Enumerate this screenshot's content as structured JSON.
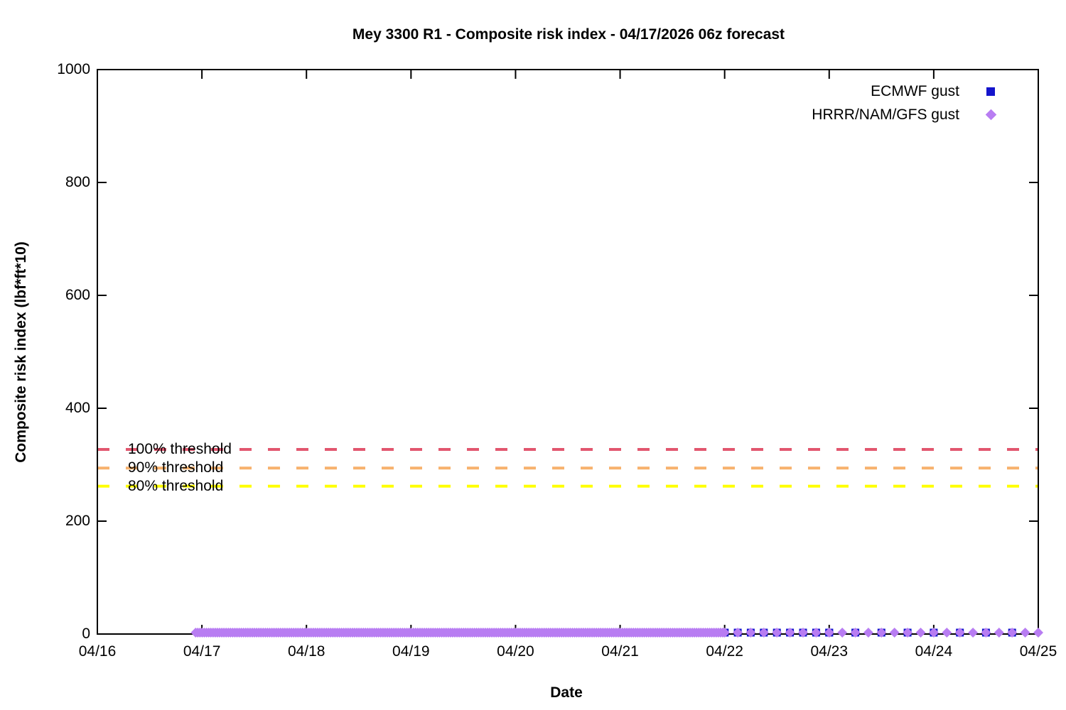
{
  "thresholds": [
    {
      "label": "100% threshold",
      "value": 327,
      "color": "#e2566e"
    },
    {
      "label": "90% threshold",
      "value": 294,
      "color": "#f7b16c"
    },
    {
      "label": "80% threshold",
      "value": 262,
      "color": "#ffff00"
    }
  ],
  "legend": {
    "items": [
      {
        "label": "ECMWF gust",
        "marker": "square",
        "color": "#1414cc"
      },
      {
        "label": "HRRR/NAM/GFS gust",
        "marker": "diamond",
        "color": "#b87df2"
      }
    ]
  },
  "chart_data": {
    "type": "scatter",
    "title": "Mey 3300 R1 - Composite risk index - 04/17/2026 06z forecast",
    "xlabel": "Date",
    "ylabel": "Composite risk index (lbf*ft*10)",
    "x_tick_labels": [
      "04/16",
      "04/17",
      "04/18",
      "04/19",
      "04/20",
      "04/21",
      "04/22",
      "04/23",
      "04/24",
      "04/25"
    ],
    "x_range_days": [
      16,
      25
    ],
    "y_ticks": [
      0,
      200,
      400,
      600,
      800,
      1000
    ],
    "ylim": [
      0,
      1000
    ],
    "grid": false,
    "legend_position": "top-right-inside",
    "series": [
      {
        "name": "ECMWF gust",
        "marker": "square",
        "color": "#1414cc",
        "value": 0,
        "sampling": [
          {
            "start_day": 17.0,
            "end_day": 22.0,
            "interval_hours": 1
          },
          {
            "start_day": 22.0,
            "end_day": 23.0,
            "interval_hours": 3
          },
          {
            "start_day": 23.0,
            "end_day": 24.75,
            "interval_hours": 6
          }
        ]
      },
      {
        "name": "HRRR/NAM/GFS gust",
        "marker": "diamond",
        "color": "#b87df2",
        "value": 0,
        "sampling": [
          {
            "start_day": 16.94,
            "end_day": 22.0,
            "interval_hours": 0.5
          },
          {
            "start_day": 22.0,
            "end_day": 25.0,
            "interval_hours": 3
          }
        ]
      }
    ]
  }
}
